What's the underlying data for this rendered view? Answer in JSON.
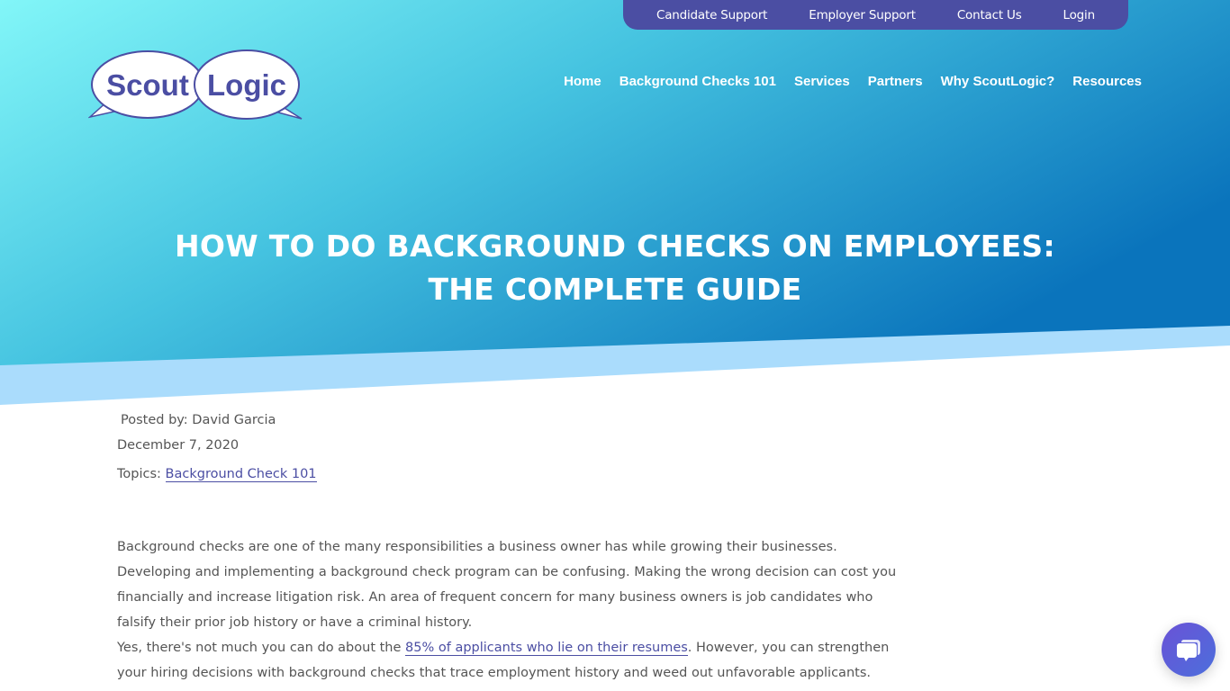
{
  "topbar": {
    "links": [
      {
        "label": "Candidate Support"
      },
      {
        "label": "Employer Support"
      },
      {
        "label": "Contact Us"
      },
      {
        "label": "Login"
      }
    ]
  },
  "logo": {
    "word1": "Scout",
    "word2": "Logic"
  },
  "nav": {
    "items": [
      {
        "label": "Home"
      },
      {
        "label": "Background Checks 101"
      },
      {
        "label": "Services"
      },
      {
        "label": "Partners"
      },
      {
        "label": "Why ScoutLogic?"
      },
      {
        "label": "Resources"
      }
    ]
  },
  "hero": {
    "title_line1": "HOW TO DO BACKGROUND CHECKS ON EMPLOYEES:",
    "title_line2": "THE COMPLETE GUIDE"
  },
  "post": {
    "author_label": "Posted by: David Garcia",
    "date": "December 7, 2020",
    "topics_label": "Topics: ",
    "topic_link": "Background Check 101"
  },
  "article": {
    "para1": "Background checks are one of the many responsibilities a business owner has while growing their businesses. Developing and implementing a background check program can be confusing. Making the wrong decision can cost you financially and increase litigation risk. An area of frequent concern for many business owners is job candidates who falsify their prior job history or have a criminal history.",
    "para2_before": "Yes, there's not much you can do about the ",
    "para2_link": "85% of applicants who lie on their resumes",
    "para2_after": ". However, you can strengthen your hiring decisions with background checks that trace employment history and weed out unfavorable applicants."
  },
  "colors": {
    "brand_purple": "#4b4ea3",
    "hero_gradient_start": "#7ef3f6",
    "hero_gradient_end": "#0a76bd",
    "hero_band": "#aadcfc"
  },
  "chat": {
    "icon": "chat-bubbles-icon"
  }
}
